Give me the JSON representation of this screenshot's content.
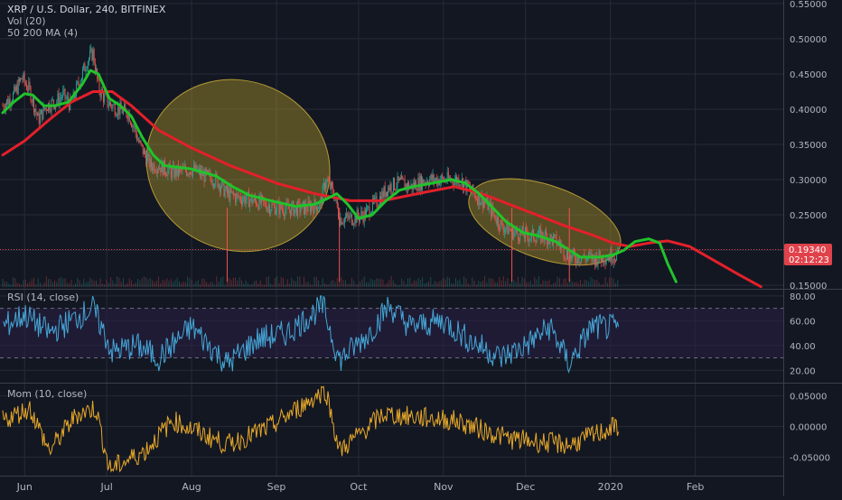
{
  "header": {
    "symbol": "XRP / U.S. Dollar, 240, BITFINEX",
    "indicator_vol": "Vol (20)",
    "indicator_ma": "50 200 MA (4)"
  },
  "price_badge": {
    "price": "0.19340",
    "countdown": "02:12:23",
    "color": "#e0424b"
  },
  "colors": {
    "background": "#131722",
    "grid": "#262b38",
    "up": "#26a69a",
    "down": "#ef5350",
    "ma_fast": "#21c32b",
    "ma_slow": "#e3202a",
    "ellipse_fill": "#b39a2a",
    "ellipse_stroke": "#d4b43a",
    "rsi_line": "#45a6d6",
    "rsi_band": "#2a1f45",
    "mom_line": "#e8a92a",
    "axis_text": "#b2b5be"
  },
  "chart_data": [
    {
      "type": "candlestick",
      "title": "XRP / U.S. Dollar, 240, BITFINEX",
      "x_tick_labels": [
        "Jun",
        "Jul",
        "Aug",
        "Sep",
        "Oct",
        "Nov",
        "Dec",
        "2020",
        "Feb"
      ],
      "y_tick_labels": [
        "0.15000",
        "0.20000",
        "0.25000",
        "0.30000",
        "0.35000",
        "0.40000",
        "0.45000",
        "0.50000",
        "0.55000"
      ],
      "ylim": [
        0.145,
        0.555
      ],
      "price_path": [
        [
          "2019-05-24",
          0.405
        ],
        [
          "2019-05-28",
          0.42
        ],
        [
          "2019-05-31",
          0.445
        ],
        [
          "2019-06-03",
          0.425
        ],
        [
          "2019-06-06",
          0.385
        ],
        [
          "2019-06-09",
          0.405
        ],
        [
          "2019-06-12",
          0.41
        ],
        [
          "2019-06-15",
          0.42
        ],
        [
          "2019-06-18",
          0.405
        ],
        [
          "2019-06-21",
          0.44
        ],
        [
          "2019-06-24",
          0.47
        ],
        [
          "2019-06-26",
          0.48
        ],
        [
          "2019-06-28",
          0.43
        ],
        [
          "2019-07-01",
          0.41
        ],
        [
          "2019-07-05",
          0.4
        ],
        [
          "2019-07-09",
          0.395
        ],
        [
          "2019-07-13",
          0.35
        ],
        [
          "2019-07-17",
          0.32
        ],
        [
          "2019-07-20",
          0.32
        ],
        [
          "2019-07-25",
          0.31
        ],
        [
          "2019-08-01",
          0.315
        ],
        [
          "2019-08-06",
          0.305
        ],
        [
          "2019-08-10",
          0.3
        ],
        [
          "2019-08-14",
          0.28
        ],
        [
          "2019-08-18",
          0.275
        ],
        [
          "2019-08-24",
          0.27
        ],
        [
          "2019-08-30",
          0.262
        ],
        [
          "2019-09-05",
          0.258
        ],
        [
          "2019-09-12",
          0.26
        ],
        [
          "2019-09-17",
          0.265
        ],
        [
          "2019-09-19",
          0.3
        ],
        [
          "2019-09-22",
          0.28
        ],
        [
          "2019-09-24",
          0.245
        ],
        [
          "2019-09-28",
          0.245
        ],
        [
          "2019-10-03",
          0.25
        ],
        [
          "2019-10-08",
          0.27
        ],
        [
          "2019-10-12",
          0.29
        ],
        [
          "2019-10-16",
          0.295
        ],
        [
          "2019-10-20",
          0.29
        ],
        [
          "2019-10-26",
          0.3
        ],
        [
          "2019-11-02",
          0.3
        ],
        [
          "2019-11-07",
          0.3
        ],
        [
          "2019-11-12",
          0.28
        ],
        [
          "2019-11-17",
          0.265
        ],
        [
          "2019-11-22",
          0.235
        ],
        [
          "2019-11-27",
          0.225
        ],
        [
          "2019-12-02",
          0.22
        ],
        [
          "2019-12-08",
          0.22
        ],
        [
          "2019-12-13",
          0.21
        ],
        [
          "2019-12-17",
          0.19
        ],
        [
          "2019-12-20",
          0.19
        ],
        [
          "2019-12-26",
          0.188
        ],
        [
          "2020-01-01",
          0.192
        ],
        [
          "2020-01-04",
          0.194
        ]
      ],
      "series": [
        {
          "name": "MA 50",
          "points": [
            [
              "2019-05-24",
              0.395
            ],
            [
              "2019-05-28",
              0.41
            ],
            [
              "2019-06-01",
              0.422
            ],
            [
              "2019-06-04",
              0.42
            ],
            [
              "2019-06-08",
              0.405
            ],
            [
              "2019-06-12",
              0.405
            ],
            [
              "2019-06-17",
              0.41
            ],
            [
              "2019-06-22",
              0.435
            ],
            [
              "2019-06-25",
              0.455
            ],
            [
              "2019-06-28",
              0.45
            ],
            [
              "2019-07-02",
              0.415
            ],
            [
              "2019-07-06",
              0.405
            ],
            [
              "2019-07-10",
              0.39
            ],
            [
              "2019-07-14",
              0.36
            ],
            [
              "2019-07-18",
              0.335
            ],
            [
              "2019-07-22",
              0.32
            ],
            [
              "2019-08-01",
              0.315
            ],
            [
              "2019-08-10",
              0.305
            ],
            [
              "2019-08-16",
              0.29
            ],
            [
              "2019-08-22",
              0.278
            ],
            [
              "2019-08-30",
              0.27
            ],
            [
              "2019-09-08",
              0.262
            ],
            [
              "2019-09-15",
              0.265
            ],
            [
              "2019-09-19",
              0.272
            ],
            [
              "2019-09-23",
              0.28
            ],
            [
              "2019-09-27",
              0.265
            ],
            [
              "2019-10-01",
              0.245
            ],
            [
              "2019-10-06",
              0.25
            ],
            [
              "2019-10-11",
              0.27
            ],
            [
              "2019-10-16",
              0.285
            ],
            [
              "2019-10-21",
              0.29
            ],
            [
              "2019-10-28",
              0.295
            ],
            [
              "2019-11-04",
              0.3
            ],
            [
              "2019-11-09",
              0.295
            ],
            [
              "2019-11-14",
              0.28
            ],
            [
              "2019-11-19",
              0.26
            ],
            [
              "2019-11-24",
              0.24
            ],
            [
              "2019-11-30",
              0.225
            ],
            [
              "2019-12-06",
              0.22
            ],
            [
              "2019-12-12",
              0.212
            ],
            [
              "2019-12-17",
              0.2
            ],
            [
              "2019-12-21",
              0.19
            ],
            [
              "2019-12-28",
              0.19
            ],
            [
              "2020-01-02",
              0.193
            ],
            [
              "2020-01-06",
              0.2
            ],
            [
              "2020-01-10",
              0.212
            ],
            [
              "2020-01-15",
              0.216
            ],
            [
              "2020-01-19",
              0.21
            ],
            [
              "2020-01-22",
              0.18
            ],
            [
              "2020-01-25",
              0.155
            ]
          ]
        },
        {
          "name": "MA 200",
          "points": [
            [
              "2019-05-24",
              0.335
            ],
            [
              "2019-06-01",
              0.355
            ],
            [
              "2019-06-10",
              0.385
            ],
            [
              "2019-06-18",
              0.41
            ],
            [
              "2019-06-26",
              0.425
            ],
            [
              "2019-07-03",
              0.425
            ],
            [
              "2019-07-10",
              0.405
            ],
            [
              "2019-07-20",
              0.37
            ],
            [
              "2019-08-01",
              0.345
            ],
            [
              "2019-08-15",
              0.32
            ],
            [
              "2019-09-01",
              0.295
            ],
            [
              "2019-09-15",
              0.28
            ],
            [
              "2019-09-28",
              0.27
            ],
            [
              "2019-10-10",
              0.27
            ],
            [
              "2019-10-25",
              0.282
            ],
            [
              "2019-11-05",
              0.29
            ],
            [
              "2019-11-15",
              0.28
            ],
            [
              "2019-11-25",
              0.265
            ],
            [
              "2019-12-05",
              0.25
            ],
            [
              "2019-12-15",
              0.235
            ],
            [
              "2019-12-25",
              0.222
            ],
            [
              "2020-01-02",
              0.21
            ],
            [
              "2020-01-08",
              0.205
            ],
            [
              "2020-01-15",
              0.21
            ],
            [
              "2020-01-22",
              0.213
            ],
            [
              "2020-01-30",
              0.205
            ],
            [
              "2020-02-08",
              0.185
            ],
            [
              "2020-02-17",
              0.165
            ],
            [
              "2020-02-25",
              0.148
            ]
          ]
        }
      ],
      "annotations": [
        {
          "shape": "ellipse",
          "center": [
            "2019-08-18",
            0.32
          ],
          "x_radius_days": 34,
          "y_radius": 0.12,
          "rotation_deg": 24
        },
        {
          "shape": "ellipse",
          "center": [
            "2019-12-08",
            0.24
          ],
          "x_radius_days": 29,
          "y_radius": 0.052,
          "rotation_deg": 19
        }
      ],
      "volume_spikes": [
        "2019-08-14",
        "2019-09-24",
        "2019-11-26",
        "2019-12-17"
      ]
    },
    {
      "type": "line",
      "title": "RSI (14, close)",
      "y_tick_labels": [
        "20.00",
        "40.00",
        "60.00",
        "80.00"
      ],
      "ylim": [
        10,
        85
      ],
      "band": [
        30,
        70
      ],
      "midline": 50,
      "anchors": [
        [
          "2019-05-24",
          55
        ],
        [
          "2019-06-01",
          65
        ],
        [
          "2019-06-10",
          50
        ],
        [
          "2019-06-18",
          60
        ],
        [
          "2019-06-26",
          70
        ],
        [
          "2019-07-03",
          35
        ],
        [
          "2019-07-12",
          40
        ],
        [
          "2019-07-20",
          30
        ],
        [
          "2019-08-01",
          55
        ],
        [
          "2019-08-14",
          25
        ],
        [
          "2019-08-25",
          45
        ],
        [
          "2019-09-05",
          50
        ],
        [
          "2019-09-18",
          72
        ],
        [
          "2019-09-24",
          28
        ],
        [
          "2019-10-05",
          50
        ],
        [
          "2019-10-12",
          72
        ],
        [
          "2019-10-20",
          55
        ],
        [
          "2019-11-01",
          60
        ],
        [
          "2019-11-10",
          45
        ],
        [
          "2019-11-22",
          30
        ],
        [
          "2019-12-01",
          40
        ],
        [
          "2019-12-10",
          55
        ],
        [
          "2019-12-17",
          25
        ],
        [
          "2019-12-25",
          55
        ],
        [
          "2020-01-04",
          54
        ]
      ]
    },
    {
      "type": "line",
      "title": "Mom (10, close)",
      "y_tick_labels": [
        "-0.05000",
        "0.00000",
        "0.05000"
      ],
      "ylim": [
        -0.08,
        0.07
      ],
      "zero_line": 0,
      "anchors": [
        [
          "2019-05-24",
          0.01
        ],
        [
          "2019-06-03",
          0.03
        ],
        [
          "2019-06-10",
          -0.04
        ],
        [
          "2019-06-20",
          0.02
        ],
        [
          "2019-06-27",
          0.03
        ],
        [
          "2019-07-02",
          -0.07
        ],
        [
          "2019-07-15",
          -0.04
        ],
        [
          "2019-07-25",
          0.01
        ],
        [
          "2019-08-14",
          -0.03
        ],
        [
          "2019-08-30",
          0.0
        ],
        [
          "2019-09-19",
          0.06
        ],
        [
          "2019-09-24",
          -0.04
        ],
        [
          "2019-10-10",
          0.02
        ],
        [
          "2019-11-05",
          0.01
        ],
        [
          "2019-11-25",
          -0.02
        ],
        [
          "2019-12-17",
          -0.03
        ],
        [
          "2020-01-04",
          0.002
        ]
      ]
    }
  ]
}
